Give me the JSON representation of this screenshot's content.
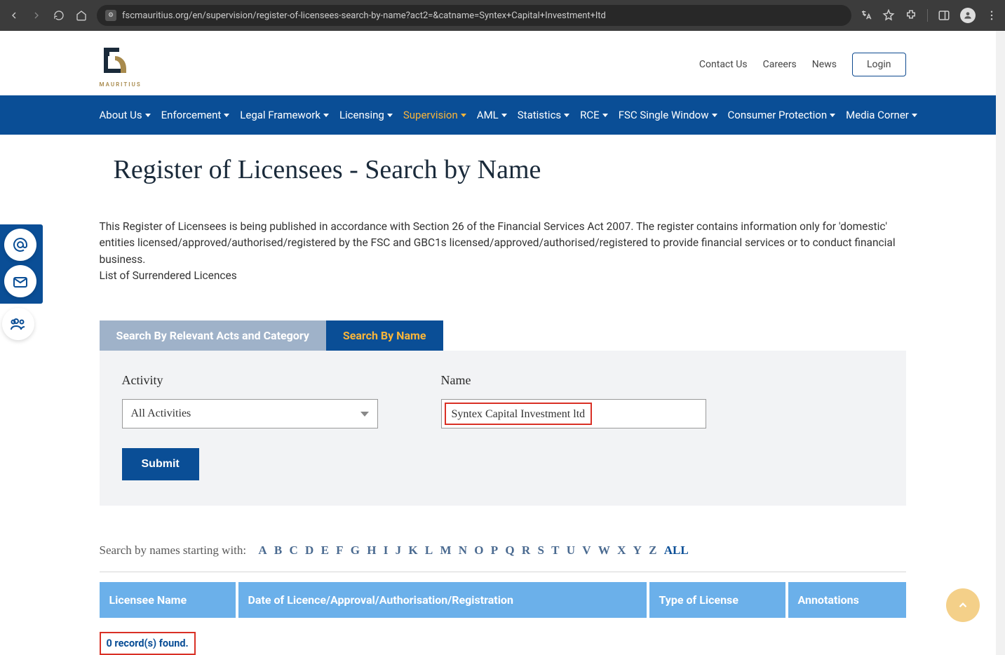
{
  "browser": {
    "url": "fscmauritius.org/en/supervision/register-of-licensees-search-by-name?act2=&catname=Syntex+Capital+Investment+ltd"
  },
  "logo": {
    "text": "MAURITIUS"
  },
  "top_links": {
    "contact": "Contact Us",
    "careers": "Careers",
    "news": "News",
    "login": "Login"
  },
  "nav": {
    "about": "About Us",
    "enforcement": "Enforcement",
    "legal": "Legal Framework",
    "licensing": "Licensing",
    "supervision": "Supervision",
    "aml": "AML",
    "statistics": "Statistics",
    "rce": "RCE",
    "ssw": "FSC Single Window",
    "consumer": "Consumer Protection",
    "media": "Media Corner"
  },
  "title": "Register of Licensees - Search by Name",
  "intro": {
    "line1": "This Register of Licensees is being published in accordance with Section 26 of the Financial Services Act 2007. The register contains information only for 'domestic' entities licensed/approved/authorised/registered by the FSC and GBC1s licensed/approved/authorised/registered to provide financial services or to conduct financial business.",
    "line2": "List of Surrendered Licences"
  },
  "tabs": {
    "by_category": "Search By Relevant Acts and Category",
    "by_name": "Search By Name"
  },
  "form": {
    "activity_label": "Activity",
    "activity_value": "All Activities",
    "name_label": "Name",
    "name_value": "Syntex Capital Investment ltd",
    "submit": "Submit"
  },
  "alpha": {
    "label": "Search by names starting with:",
    "letters": [
      "A",
      "B",
      "C",
      "D",
      "E",
      "F",
      "G",
      "H",
      "I",
      "J",
      "K",
      "L",
      "M",
      "N",
      "O",
      "P",
      "Q",
      "R",
      "S",
      "T",
      "U",
      "V",
      "W",
      "X",
      "Y",
      "Z"
    ],
    "all": "ALL"
  },
  "table": {
    "licensee": "Licensee Name",
    "date": "Date of Licence/Approval/Authorisation/Registration",
    "type": "Type of License",
    "annotations": "Annotations"
  },
  "records_found": "0 record(s) found."
}
